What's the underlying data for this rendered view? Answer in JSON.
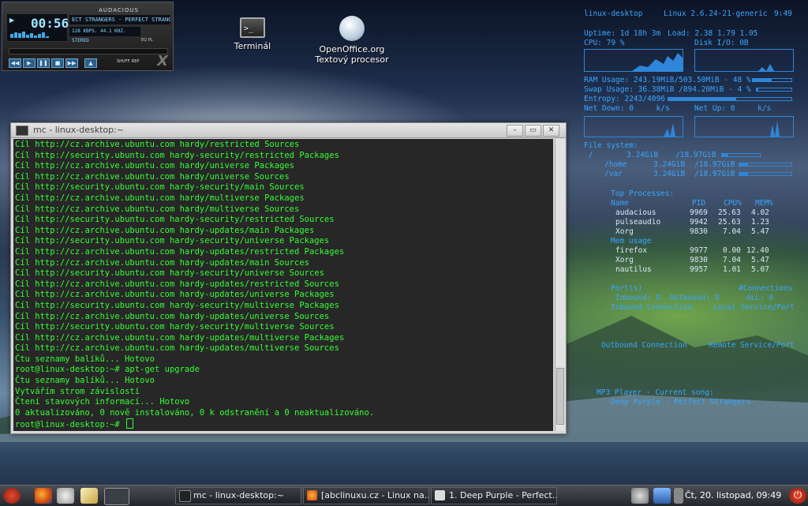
{
  "player": {
    "app_title": "AUDACIOUS",
    "time": "00:56",
    "song_scroll": "ECT STRANGERS - PERFECT STRANGE",
    "info": "128 KBPS. 44.1 KHZ. STEREO",
    "toggles": "EQ   PL",
    "buttons": [
      "◀◀",
      "▶",
      "❚❚",
      "■",
      "▶▶",
      "▲"
    ],
    "extra": "SHUFF.   REP"
  },
  "desktop_icons": {
    "terminal": "Terminál",
    "openoffice": "OpenOffice.org Textový procesor"
  },
  "conky": {
    "host": "linux-desktop",
    "kernel": "Linux 2.6.24-21-generic",
    "clock": "9:49",
    "uptime": "Uptime: 1d 18h 3m",
    "load": "Load: 2.38 1.79 1.05",
    "cpu": "CPU: 79 %",
    "disk_io": "Disk I/O: 0B",
    "ram": "RAM Usage: 243.19MiB/503.50MiB - 48 %",
    "ram_pct": 48,
    "swap": "Swap Usage: 36.38MiB /894.20MiB - 4 %",
    "swap_pct": 4,
    "entropy": "Entropy: 2243/4096",
    "entropy_pct": 55,
    "net_down": "Net Down: 0     k/s",
    "net_up": "Net Up: 0     k/s",
    "fs_header": "File system:",
    "filesystems": [
      {
        "mount": " /",
        "used": "3.24GiB",
        "total": "/18.97GiB",
        "pct": 17
      },
      {
        "mount": "/home",
        "used": "3.24GiB",
        "total": "/18.97GiB",
        "pct": 17
      },
      {
        "mount": "/var",
        "used": "3.24GiB",
        "total": "/18.97GiB",
        "pct": 17
      }
    ],
    "top_header": "Top Processes:",
    "top_columns": "Name              PID    CPU%   MEM%",
    "top_cpu": [
      {
        "name": "audacious",
        "pid": "9969",
        "cpu": "25.63",
        "mem": "4.02"
      },
      {
        "name": "pulseaudio",
        "pid": "9942",
        "cpu": "25.63",
        "mem": "1.23"
      },
      {
        "name": "Xorg",
        "pid": "9830",
        "cpu": "7.04",
        "mem": "5.47"
      }
    ],
    "mem_header": "Mem usage",
    "top_mem": [
      {
        "name": "firefox",
        "pid": "9977",
        "cpu": "0.00",
        "mem": "12.40"
      },
      {
        "name": "Xorg",
        "pid": "9830",
        "cpu": "7.04",
        "mem": "5.47"
      },
      {
        "name": "nautilus",
        "pid": "9957",
        "cpu": "1.01",
        "mem": "5.07"
      }
    ],
    "ports": "Port(s)",
    "connections": "#Connections",
    "inbound_line": "Inbound: 0  Outbound: 0      ALL: 0",
    "inbound_conn": "Inbound Connection",
    "local_service": "Local Service/Port",
    "outbound_conn": "Outbound Connection",
    "remote_service": "Remote Service/Port",
    "mp3_label": "MP3 Player - Current song:",
    "mp3_song": "Deep Purple - Perfect Strangers"
  },
  "terminal": {
    "title": "mc - linux-desktop:~",
    "lines": [
      "Cíl http://cz.archive.ubuntu.com hardy/restricted Sources",
      "Cíl http://security.ubuntu.com hardy-security/restricted Packages",
      "Cíl http://cz.archive.ubuntu.com hardy/universe Packages",
      "Cíl http://cz.archive.ubuntu.com hardy/universe Sources",
      "Cíl http://security.ubuntu.com hardy-security/main Sources",
      "Cíl http://cz.archive.ubuntu.com hardy/multiverse Packages",
      "Cíl http://cz.archive.ubuntu.com hardy/multiverse Sources",
      "Cíl http://security.ubuntu.com hardy-security/restricted Sources",
      "Cíl http://cz.archive.ubuntu.com hardy-updates/main Packages",
      "Cíl http://security.ubuntu.com hardy-security/universe Packages",
      "Cíl http://cz.archive.ubuntu.com hardy-updates/restricted Packages",
      "Cíl http://cz.archive.ubuntu.com hardy-updates/main Sources",
      "Cíl http://security.ubuntu.com hardy-security/universe Sources",
      "Cíl http://cz.archive.ubuntu.com hardy-updates/restricted Sources",
      "Cíl http://cz.archive.ubuntu.com hardy-updates/universe Packages",
      "Cíl http://security.ubuntu.com hardy-security/multiverse Packages",
      "Cíl http://cz.archive.ubuntu.com hardy-updates/universe Sources",
      "Cíl http://security.ubuntu.com hardy-security/multiverse Sources",
      "Cíl http://cz.archive.ubuntu.com hardy-updates/multiverse Packages",
      "Cíl http://cz.archive.ubuntu.com hardy-updates/multiverse Sources",
      "Čtu seznamy balíků... Hotovo",
      "root@linux-desktop:~# apt-get upgrade",
      "Čtu seznamy balíků... Hotovo",
      "Vytvářím strom závislostí",
      "Čtení stavových informací... Hotovo",
      "0 aktualizováno, 0 nově instalováno, 0 k odstranění a 0 neaktualizováno."
    ],
    "prompt": "root@linux-desktop:~# "
  },
  "taskbar": {
    "tasks": [
      "mc - linux-desktop:~",
      "[abclinuxu.cz - Linux na...",
      "1. Deep Purple - Perfect..."
    ],
    "clock": "Čt, 20. listopad, 09:49"
  },
  "colors": {
    "terminal_text": "#33ff33",
    "conky_text": "#39a6ff"
  }
}
